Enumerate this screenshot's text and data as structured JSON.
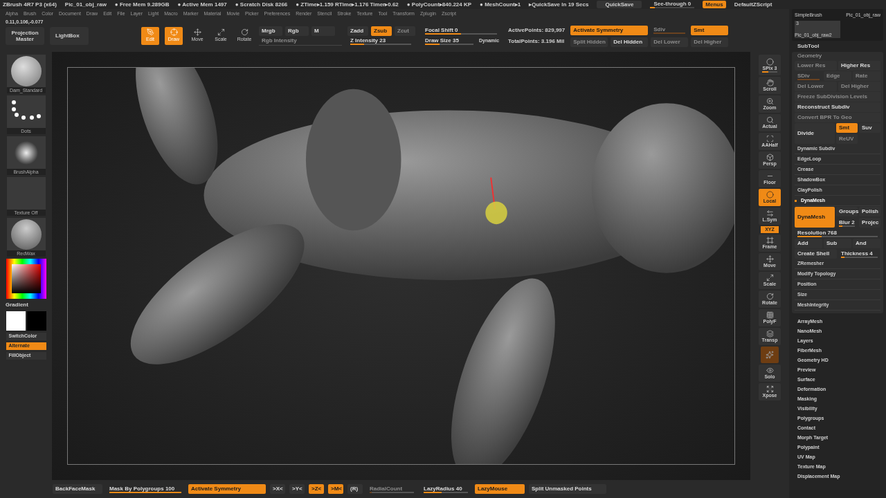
{
  "title_bar": {
    "app": "ZBrush 4R7 P3 (x64)",
    "document": "Pic_01_obj_raw",
    "stats": [
      "● Free Mem 9.289GB",
      "● Active Mem 1497",
      "● Scratch Disk 8266",
      "● ZTime▸1.159 RTime▸1.176 Timer▸0.62",
      "● PolyCount▸840.224 KP",
      "● MeshCount▸1"
    ],
    "quicksave_info": "▸QuickSave In 19 Secs",
    "quicksave_button": "QuickSave",
    "see_through": {
      "label": "See-through 0",
      "level": 0.1
    },
    "menus_button": {
      "label": "Menus",
      "on": true
    },
    "script_button": "DefaultZScript"
  },
  "menu_bar": [
    "Alpha",
    "Brush",
    "Color",
    "Document",
    "Draw",
    "Edit",
    "File",
    "Layer",
    "Light",
    "Macro",
    "Marker",
    "Material",
    "Movie",
    "Picker",
    "Preferences",
    "Render",
    "Stencil",
    "Stroke",
    "Texture",
    "Tool",
    "Transform",
    "Zplugin",
    "Zscript"
  ],
  "coordinates": "0.11,0.106,-0.077",
  "shelf": {
    "projection_master": "Projection Master",
    "lightbox": "LightBox",
    "modes": [
      {
        "label": "Edit",
        "on": true
      },
      {
        "label": "Draw",
        "on": true
      },
      {
        "label": "Move",
        "on": false
      },
      {
        "label": "Scale",
        "on": false
      },
      {
        "label": "Rotate",
        "on": false
      }
    ],
    "color_modes": [
      {
        "label": "Mrgb",
        "on": false,
        "disabled": false
      },
      {
        "label": "Rgb",
        "on": false,
        "disabled": false
      },
      {
        "label": "M",
        "on": false,
        "disabled": false
      }
    ],
    "rgb_intensity": {
      "label": "Rgb Intensity",
      "disabled": true
    },
    "z_modes": [
      {
        "label": "Zadd",
        "on": false,
        "disabled": false
      },
      {
        "label": "Zsub",
        "on": true,
        "disabled": false
      },
      {
        "label": "Zcut",
        "on": false,
        "disabled": true
      }
    ],
    "z_intensity": {
      "label": "Z Intensity 23",
      "level": 0.23
    },
    "focal_shift": {
      "label": "Focal Shift 0",
      "level": 0.5
    },
    "draw_size": {
      "label": "Draw Size 35",
      "level": 0.3
    },
    "dynamic": "Dynamic",
    "active_points": "ActivePoints: 829,997",
    "total_points": "TotalPoints: 3.196 Mil",
    "row1": [
      {
        "label": "Activate Symmetry",
        "kind": "button",
        "on": true,
        "disabled": false
      },
      {
        "label": "Sdiv",
        "kind": "slider",
        "level": 1,
        "on": false,
        "disabled": true
      },
      {
        "label": "Smt",
        "kind": "button",
        "on": true,
        "disabled": false
      }
    ],
    "row2": [
      {
        "label": "Split Hidden",
        "on": false,
        "disabled": true
      },
      {
        "label": "Del Hidden",
        "on": false,
        "disabled": false
      },
      {
        "label": "Del Lower",
        "on": false,
        "disabled": true
      },
      {
        "label": "Del Higher",
        "on": false,
        "disabled": true
      }
    ]
  },
  "left_column": {
    "thumbnails": [
      {
        "label": "Dam_Standard",
        "kind": "brush"
      },
      {
        "label": "Dots",
        "kind": "stroke"
      },
      {
        "label": "BrushAlpha",
        "kind": "alpha"
      },
      {
        "label": "Texture Off",
        "kind": "texture"
      },
      {
        "label": "RedWax",
        "kind": "material"
      }
    ],
    "gradient": "Gradient",
    "buttons": [
      {
        "label": "SwitchColor",
        "on": false
      },
      {
        "label": "Alternate",
        "on": true
      },
      {
        "label": "FillObject",
        "on": false
      }
    ]
  },
  "right_toolbar": [
    {
      "label": "SPix 3",
      "kind": "slider",
      "level": 0.4,
      "on": false
    },
    {
      "label": "Scroll",
      "kind": "button",
      "on": false
    },
    {
      "label": "Zoom",
      "kind": "button",
      "on": false
    },
    {
      "label": "Actual",
      "kind": "button",
      "on": false
    },
    {
      "label": "AAHalf",
      "kind": "button",
      "on": false
    },
    {
      "label": "Persp",
      "kind": "button",
      "on": false
    },
    {
      "label": "Floor",
      "kind": "button",
      "on": false
    },
    {
      "label": "Local",
      "kind": "button",
      "on": true
    },
    {
      "label": "L.Sym",
      "kind": "button",
      "on": false
    },
    {
      "label": "XYZ",
      "kind": "small",
      "on": true
    },
    {
      "label": "Frame",
      "kind": "button",
      "on": false
    },
    {
      "label": "Move",
      "kind": "button",
      "on": false
    },
    {
      "label": "Scale",
      "kind": "button",
      "on": false
    },
    {
      "label": "Rotate",
      "kind": "button",
      "on": false
    },
    {
      "label": "PolyF",
      "kind": "button",
      "on": false
    },
    {
      "label": "Transp",
      "kind": "button",
      "on": false
    },
    {
      "kind": "dim",
      "on": true
    },
    {
      "label": "Solo",
      "kind": "button",
      "on": false
    },
    {
      "label": "Xpose",
      "kind": "button",
      "on": false
    }
  ],
  "right_panel": {
    "brush": "SimpleBrush",
    "tool": "Pic_01_obj_raw",
    "subtool_count": "3",
    "subtool_name": "Pic_01_obj_raw2",
    "subtool_header": "SubTool",
    "geometry_title": "Geometry",
    "rows": [
      {
        "kind": "flat",
        "items": [
          {
            "label": "Lower Res",
            "kind": "button",
            "on": false,
            "disabled": true
          },
          {
            "label": "Higher Res",
            "kind": "button",
            "on": false,
            "disabled": false
          }
        ]
      },
      {
        "kind": "flat",
        "items": [
          {
            "label": "SDiv",
            "kind": "slider",
            "level": 1,
            "on": false,
            "disabled": true
          },
          {
            "label": "Edge",
            "kind": "button",
            "on": false,
            "disabled": true
          },
          {
            "label": "Rate",
            "kind": "button",
            "on": false,
            "disabled": true
          }
        ]
      },
      {
        "kind": "flat",
        "items": [
          {
            "label": "Del Lower",
            "kind": "button",
            "on": false,
            "disabled": true
          },
          {
            "label": "Del Higher",
            "kind": "button",
            "on": false,
            "disabled": true
          }
        ]
      },
      {
        "kind": "flat",
        "items": [
          {
            "label": "Freeze SubDivision Levels",
            "kind": "button",
            "on": false,
            "disabled": true
          }
        ]
      },
      {
        "kind": "flat",
        "items": [
          {
            "label": "Reconstruct Subdiv",
            "kind": "button",
            "on": false,
            "disabled": false
          }
        ]
      },
      {
        "kind": "flat",
        "items": [
          {
            "label": "Convert BPR To Geo",
            "kind": "button",
            "on": false,
            "disabled": true
          }
        ]
      },
      {
        "kind": "split",
        "items": [
          {
            "label": "Divide",
            "kind": "button",
            "on": false,
            "disabled": false
          },
          {
            "label": "Smt",
            "kind": "button",
            "on": true,
            "disabled": false
          },
          {
            "label": "Suv",
            "kind": "button",
            "on": false,
            "disabled": false
          },
          {
            "label": "ReUV",
            "kind": "button",
            "on": false,
            "disabled": true
          }
        ]
      },
      {
        "kind": "section",
        "items": [
          {
            "label": "Dynamic Subdiv"
          }
        ]
      },
      {
        "kind": "section",
        "items": [
          {
            "label": "EdgeLoop"
          }
        ]
      },
      {
        "kind": "section",
        "items": [
          {
            "label": "Crease"
          }
        ]
      },
      {
        "kind": "section",
        "items": [
          {
            "label": "ShadowBox"
          }
        ]
      },
      {
        "kind": "section",
        "items": [
          {
            "label": "ClayPolish"
          }
        ]
      },
      {
        "kind": "open-section",
        "items": [
          {
            "label": "DynaMesh"
          }
        ]
      },
      {
        "kind": "split",
        "items": [
          {
            "label": "DynaMesh",
            "kind": "button",
            "on": true,
            "disabled": false
          },
          {
            "label": "Groups",
            "kind": "button",
            "on": false,
            "disabled": false
          },
          {
            "label": "Polish",
            "kind": "button",
            "on": false,
            "disabled": false
          },
          {
            "label": "Blur 2",
            "kind": "slider",
            "level": 0.2,
            "on": false,
            "disabled": false
          },
          {
            "label": "Projec",
            "kind": "button",
            "on": false,
            "disabled": false
          }
        ]
      },
      {
        "kind": "flat",
        "items": [
          {
            "label": "Resolution 768",
            "kind": "slider",
            "level": 0.3,
            "on": false,
            "disabled": false
          }
        ]
      },
      {
        "kind": "flat",
        "items": [
          {
            "label": "Add",
            "kind": "button",
            "on": false,
            "disabled": false
          },
          {
            "label": "Sub",
            "kind": "button",
            "on": false,
            "disabled": false
          },
          {
            "label": "And",
            "kind": "button",
            "on": false,
            "disabled": false
          }
        ]
      },
      {
        "kind": "flat",
        "items": [
          {
            "label": "Create Shell",
            "kind": "button",
            "on": false,
            "disabled": false
          },
          {
            "label": "Thickness 4",
            "kind": "slider",
            "level": 0.1,
            "on": false,
            "disabled": false
          }
        ]
      },
      {
        "kind": "section",
        "items": [
          {
            "label": "ZRemesher"
          }
        ]
      },
      {
        "kind": "section",
        "items": [
          {
            "label": "Modify Topology"
          }
        ]
      },
      {
        "kind": "section",
        "items": [
          {
            "label": "Position"
          }
        ]
      },
      {
        "kind": "section",
        "items": [
          {
            "label": "Size"
          }
        ]
      },
      {
        "kind": "section",
        "items": [
          {
            "label": "MeshIntegrity"
          }
        ]
      }
    ],
    "sections": [
      "ArrayMesh",
      "NanoMesh",
      "Layers",
      "FiberMesh",
      "Geometry HD",
      "Preview",
      "Surface",
      "Deformation",
      "Masking",
      "Visibility",
      "Polygroups",
      "Contact",
      "Morph Target",
      "Polypaint",
      "UV Map",
      "Texture Map",
      "Displacement Map"
    ]
  },
  "bottom_bar": [
    {
      "label": "BackFaceMask",
      "kind": "button",
      "on": false,
      "disabled": false
    },
    {
      "label": "Mask By Polygroups 100",
      "kind": "slider",
      "level": 1,
      "on": false,
      "disabled": false
    },
    {
      "label": "Activate Symmetry",
      "kind": "button",
      "on": true,
      "disabled": false
    },
    {
      "label": ">X<",
      "kind": "button",
      "on": false,
      "disabled": false
    },
    {
      "label": ">Y<",
      "kind": "button",
      "on": false,
      "disabled": false
    },
    {
      "label": ">Z<",
      "kind": "button",
      "on": true,
      "disabled": false
    },
    {
      "label": ">M<",
      "kind": "button",
      "on": true,
      "disabled": false
    },
    {
      "label": "(R)",
      "kind": "button",
      "on": false,
      "disabled": false
    },
    {
      "label": "RadialCount",
      "kind": "slider",
      "level": 0.05,
      "on": false,
      "disabled": true
    },
    {
      "label": "LazyRadius 40",
      "kind": "slider",
      "level": 0.4,
      "on": false,
      "disabled": false
    },
    {
      "label": "LazyMouse",
      "kind": "button",
      "on": true,
      "disabled": false
    },
    {
      "label": "Split Unmasked Points",
      "kind": "button",
      "on": false,
      "disabled": false
    }
  ]
}
